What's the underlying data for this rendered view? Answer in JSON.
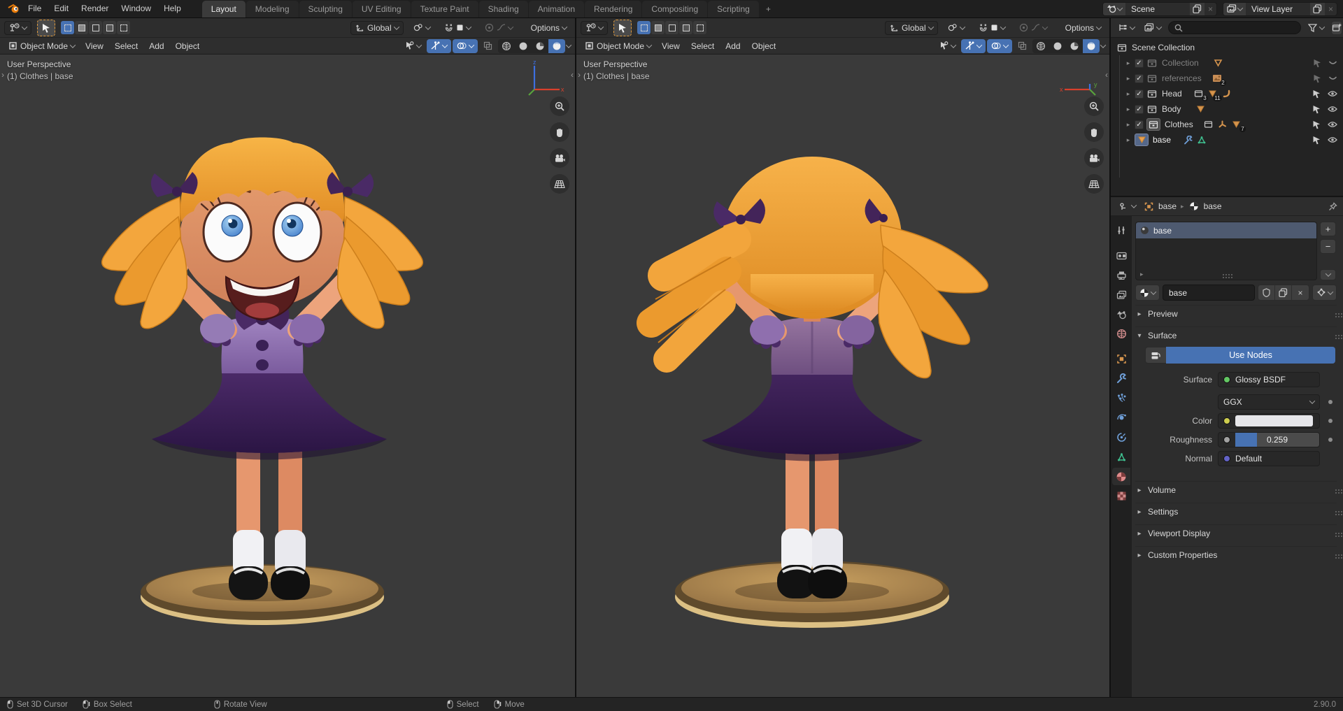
{
  "app": {
    "version": "2.90.0"
  },
  "colors": {
    "accent": "#4772b3",
    "topbar_bg": "#1f1f1f",
    "header_bg": "#2e2e2e",
    "viewport_bg": "#3a3a3a",
    "outliner_bg": "#232323",
    "props_bg": "#2d2d2d",
    "hair": "#f0a13a",
    "dress": "#9678b8",
    "skirt": "#3a2158",
    "skin": "#e0906a",
    "disc_gold": "#c9a05e"
  },
  "topbar": {
    "menus": [
      "File",
      "Edit",
      "Render",
      "Window",
      "Help"
    ],
    "tabs": [
      "Layout",
      "Modeling",
      "Sculpting",
      "UV Editing",
      "Texture Paint",
      "Shading",
      "Animation",
      "Rendering",
      "Compositing",
      "Scripting"
    ],
    "add_tab": "+",
    "scene": "Scene",
    "view_layer": "View Layer"
  },
  "vp": {
    "mode": "Object Mode",
    "menus": [
      "View",
      "Select",
      "Add",
      "Object"
    ],
    "orientation": "Global",
    "options": "Options",
    "overlay": {
      "line1": "User Perspective",
      "line2": "(1) Clothes | base"
    },
    "axis": {
      "x": "x",
      "y": "y",
      "z": "z"
    }
  },
  "outliner": {
    "root": "Scene Collection",
    "rows": [
      {
        "name": "Collection"
      },
      {
        "name": "references",
        "badge": "2"
      },
      {
        "name": "Head",
        "badge_instances": "3",
        "badge_mesh": "11"
      },
      {
        "name": "Body"
      },
      {
        "name": "Clothes",
        "badge_mesh": "7"
      },
      {
        "name": "base"
      }
    ]
  },
  "properties": {
    "breadcrumb": {
      "object": "base",
      "material": "base"
    },
    "slots": [
      {
        "name": "base"
      }
    ],
    "material_name": "base",
    "surface": {
      "use_nodes": "Use Nodes",
      "surface_label": "Surface",
      "surface_value": "Glossy BSDF",
      "distribution": "GGX",
      "color_label": "Color",
      "roughness_label": "Roughness",
      "roughness_value": "0.259",
      "roughness_fraction": 0.259,
      "normal_label": "Normal",
      "normal_value": "Default"
    },
    "panels": {
      "preview": "Preview",
      "surface": "Surface",
      "volume": "Volume",
      "settings": "Settings",
      "viewport_display": "Viewport Display",
      "custom_properties": "Custom Properties"
    }
  },
  "statusbar": {
    "items": [
      "Set 3D Cursor",
      "Box Select",
      "Rotate View",
      "Select",
      "Move"
    ],
    "version": "2.90.0"
  }
}
